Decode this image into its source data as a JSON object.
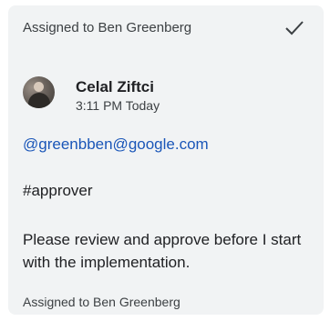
{
  "header": {
    "title": "Assigned to Ben Greenberg",
    "resolve_icon": "checkmark-icon"
  },
  "comment": {
    "author": "Celal Ziftci",
    "time": "3:11 PM Today",
    "avatar_icon": "user-photo-avatar",
    "mention": "@greenbben@google.com",
    "hashtag": "#approver",
    "body": "Please review and approve before I start with the implementation."
  },
  "footer": {
    "text": "Assigned to Ben Greenberg"
  },
  "colors": {
    "card_background": "#f1f3f4",
    "link": "#1a56b8",
    "text": "#202124"
  }
}
